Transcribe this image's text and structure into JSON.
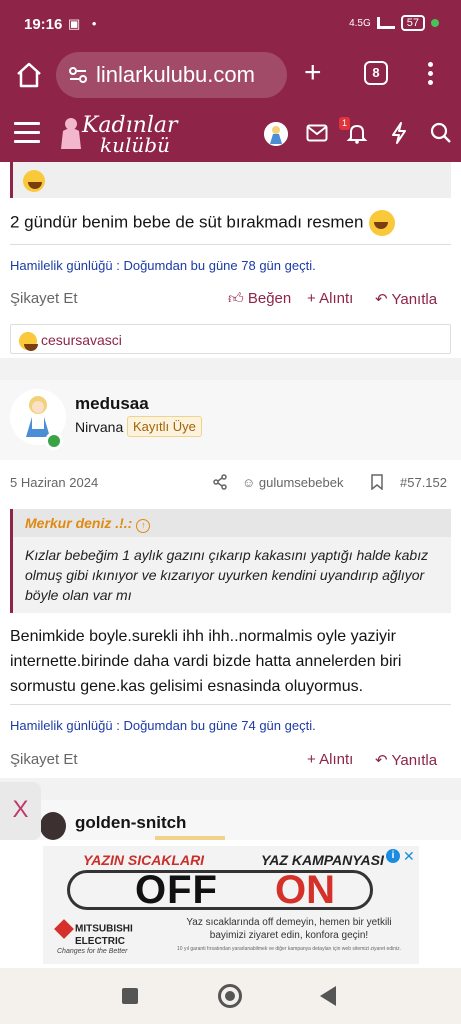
{
  "status_bar": {
    "time": "19:16",
    "icons": "▣ •",
    "network": "4.5G",
    "battery": "57"
  },
  "browser": {
    "url": "linlarkulubu.com",
    "tab_count": "8",
    "new_tab_label": "+"
  },
  "site_nav": {
    "logo_line1": "Kadınlar",
    "logo_line2": "kulübü",
    "alert_badge": "1"
  },
  "previous_post": {
    "text": "2 gündür benim bebe de süt bırakmadı resmen",
    "signature": "Hamilelik günlüğü : Doğumdan bu güne 78 gün geçti.",
    "report_label": "Şikayet Et",
    "like_label": "Beğen",
    "quote_label": "Alıntı",
    "reply_label": "Yanıtla",
    "reaction_user": "cesursavasci"
  },
  "post": {
    "username": "medusaa",
    "rank": "Nirvana",
    "badge": "Kayıtlı Üye",
    "date": "5 Haziran 2024",
    "quoted_user": "gulumsebebek",
    "post_number": "#57.152",
    "quote_author": "Merkur deniz .!.:",
    "quote_text": "Kızlar bebeğim 1 aylık gazını çıkarıp kakasını yaptığı halde kabız olmuş gibi ıkınıyor ve kızarıyor uyurken kendini uyandırıp ağlıyor böyle olan var mı",
    "text": "Benimkide boyle.surekli ihh ihh..normalmis oyle yaziyir internette.birinde daha vardi bizde hatta annelerden biri sormustu gene.kas gelisimi esnasinda oluyormus.",
    "signature": "Hamilelik günlüğü : Doğumdan bu güne 74 gün geçti.",
    "report_label": "Şikayet Et",
    "quote_label": "Alıntı",
    "reply_label": "Yanıtla"
  },
  "next_post": {
    "username": "golden-snitch"
  },
  "ad": {
    "close_label": "X",
    "headline_left": "YAZIN SICAKLARI",
    "headline_right": "YAZ KAMPANYASI",
    "off": "OFF",
    "on": "ON",
    "brand_line1": "MITSUBISHI",
    "brand_line2": "ELECTRIC",
    "slogan": "Changes for the Better",
    "copy": "Yaz sıcaklarında off demeyin, hemen bir yetkili bayimizi ziyaret edin, konfora geçin!",
    "fine_print": "10 yıl garanti fırsatından yararlanabilmek ve diğer kampanya detayları için web sitemizi ziyaret ediniz.",
    "colors": {
      "red": "#d6302b",
      "info_blue": "#1a8de0"
    }
  },
  "theme": {
    "brand": "#8e2448",
    "link": "#1d3aa5",
    "online": "#3aa345"
  }
}
